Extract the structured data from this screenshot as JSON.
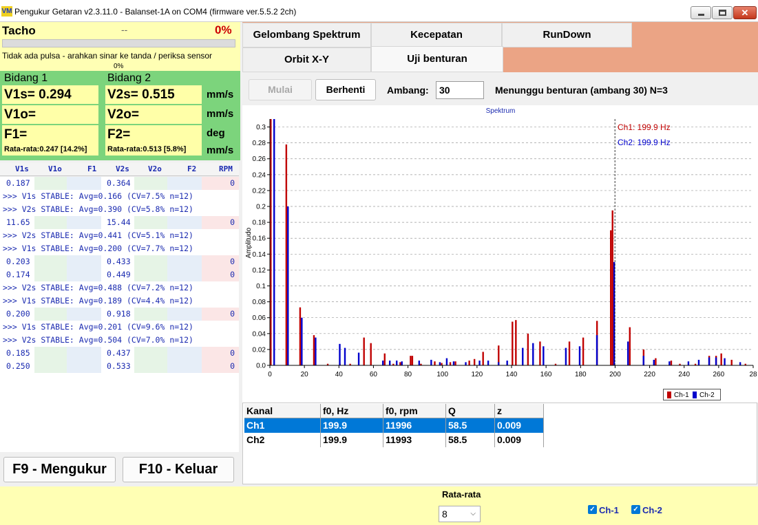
{
  "window": {
    "title": "Pengukur Getaran v2.3.11.0 - Balanset-1A on COM4 (firmware ver.5.5.2 2ch)",
    "icon_text": "VM",
    "close_glyph": "✕"
  },
  "tacho": {
    "label": "Tacho",
    "rpm": "--",
    "percent": "0%",
    "progress": 0,
    "message": "Tidak ada pulsa - arahkan sinar ke tanda / periksa sensor",
    "bar_percent": "0%"
  },
  "bidang1": {
    "title": "Bidang 1",
    "v1s": "V1s= 0.294",
    "v1o": "V1o=",
    "f1": "F1=",
    "avg": "Rata-rata:0.247 [14.2%]"
  },
  "bidang2": {
    "title": "Bidang 2",
    "v2s": "V2s= 0.515",
    "v2o": "V2o=",
    "f2": "F2=",
    "avg": "Rata-rata:0.513 [5.8%]"
  },
  "units": [
    "mm/s",
    "mm/s",
    "deg",
    "mm/s"
  ],
  "log_columns": [
    "V1s",
    "V1o",
    "F1",
    "V2s",
    "V2o",
    "F2",
    "RPM"
  ],
  "log_rows": [
    {
      "type": "data",
      "v1s": "0.187",
      "v2s": "0.364",
      "rpm": "0"
    },
    {
      "type": "stable",
      "text": ">>> V1s STABLE: Avg=0.166 (CV=7.5% n=12)"
    },
    {
      "type": "stable",
      "text": ">>> V2s STABLE: Avg=0.390 (CV=5.8% n=12)"
    },
    {
      "type": "data",
      "v1s": "11.65",
      "v2s": "15.44",
      "rpm": "0"
    },
    {
      "type": "stable",
      "text": ">>> V2s STABLE: Avg=0.441 (CV=5.1% n=12)"
    },
    {
      "type": "stable",
      "text": ">>> V1s STABLE: Avg=0.200 (CV=7.7% n=12)"
    },
    {
      "type": "data",
      "v1s": "0.203",
      "v2s": "0.433",
      "rpm": "0"
    },
    {
      "type": "data",
      "v1s": "0.174",
      "v2s": "0.449",
      "rpm": "0"
    },
    {
      "type": "stable",
      "text": ">>> V2s STABLE: Avg=0.488 (CV=7.2% n=12)"
    },
    {
      "type": "stable",
      "text": ">>> V1s STABLE: Avg=0.189 (CV=4.4% n=12)"
    },
    {
      "type": "data",
      "v1s": "0.200",
      "v2s": "0.918",
      "rpm": "0"
    },
    {
      "type": "stable",
      "text": ">>> V1s STABLE: Avg=0.201 (CV=9.6% n=12)"
    },
    {
      "type": "stable",
      "text": ">>> V2s STABLE: Avg=0.504 (CV=7.0% n=12)"
    },
    {
      "type": "data",
      "v1s": "0.185",
      "v2s": "0.437",
      "rpm": "0"
    },
    {
      "type": "data",
      "v1s": "0.250",
      "v2s": "0.533",
      "rpm": "0"
    }
  ],
  "buttons": {
    "measure": "F9 - Mengukur",
    "exit": "F10 - Keluar",
    "start": "Mulai",
    "stop": "Berhenti"
  },
  "tabs": {
    "row1": [
      "Gelombang  Spektrum",
      "Kecepatan",
      "RunDown"
    ],
    "row2": [
      "Orbit X-Y",
      "Uji benturan"
    ],
    "active": "Uji benturan"
  },
  "toolbar": {
    "threshold_label": "Ambang:",
    "threshold_value": "30",
    "status": "Menunggu benturan (ambang 30)  N=3"
  },
  "chart_data": {
    "type": "bar",
    "title": "Spektrum",
    "xlabel": "",
    "ylabel": "Amplitudo",
    "xlim": [
      0,
      280
    ],
    "ylim": [
      0,
      0.31
    ],
    "x_ticks": [
      0,
      20,
      40,
      60,
      80,
      100,
      120,
      140,
      160,
      180,
      200,
      220,
      240,
      260,
      280
    ],
    "x_tick_labels": [
      "0",
      "20",
      "40",
      "60",
      "80",
      "100",
      "120",
      "140",
      "160",
      "180",
      "200",
      "220",
      "240",
      "260",
      "28"
    ],
    "y_ticks": [
      0.0,
      0.02,
      0.04,
      0.06,
      0.08,
      0.1,
      0.12,
      0.14,
      0.16,
      0.18,
      0.2,
      0.22,
      0.24,
      0.26,
      0.28,
      0.3
    ],
    "y_tick_labels": [
      "0.0",
      "0.02",
      "0.04",
      "0.06",
      "0.08",
      "0.1",
      "0.12",
      "0.14",
      "0.16",
      "0.18",
      "0.2",
      "0.22",
      "0.24",
      "0.26",
      "0.28",
      "0.3"
    ],
    "grid": true,
    "legend": "bottom-right",
    "marker": {
      "x": 199.9
    },
    "annotations": [
      "Ch1: 199.9 Hz",
      "Ch2: 199.9 Hz"
    ],
    "series": [
      {
        "name": "Ch-1",
        "color": "#c00000",
        "x": [
          1,
          10,
          18,
          26,
          34,
          41,
          47,
          55,
          59,
          67,
          72,
          76,
          82,
          83,
          88,
          96,
          100,
          105,
          108,
          116,
          119,
          124,
          133,
          141,
          143,
          150,
          157,
          166,
          174,
          182,
          190,
          198,
          199,
          209,
          217,
          224,
          233,
          238,
          247,
          255,
          259,
          262,
          268,
          276
        ],
        "values": [
          0.31,
          0.278,
          0.073,
          0.038,
          0.002,
          0.002,
          0.002,
          0.035,
          0.028,
          0.015,
          0.002,
          0.004,
          0.012,
          0.012,
          0.002,
          0.005,
          0.003,
          0.004,
          0.005,
          0.006,
          0.008,
          0.017,
          0.025,
          0.055,
          0.057,
          0.04,
          0.03,
          0.002,
          0.03,
          0.035,
          0.056,
          0.17,
          0.195,
          0.048,
          0.02,
          0.009,
          0.006,
          0.002,
          0.002,
          0.012,
          0.012,
          0.015,
          0.007,
          0.002
        ]
      },
      {
        "name": "Ch-2",
        "color": "#0000cc",
        "x": [
          2,
          10,
          18,
          26,
          40,
          43,
          51,
          65,
          69,
          73,
          76,
          86,
          93,
          98,
          102,
          106,
          113,
          121,
          126,
          132,
          137,
          146,
          152,
          158,
          171,
          179,
          189,
          199,
          207,
          216,
          222,
          231,
          242,
          248,
          254,
          258,
          263,
          272
        ],
        "values": [
          0.31,
          0.2,
          0.06,
          0.035,
          0.027,
          0.022,
          0.016,
          0.006,
          0.006,
          0.006,
          0.005,
          0.006,
          0.007,
          0.004,
          0.009,
          0.005,
          0.004,
          0.006,
          0.006,
          0.004,
          0.006,
          0.022,
          0.028,
          0.024,
          0.022,
          0.024,
          0.038,
          0.13,
          0.03,
          0.012,
          0.007,
          0.005,
          0.005,
          0.007,
          0.01,
          0.01,
          0.009,
          0.004
        ]
      }
    ]
  },
  "result_table": {
    "columns": [
      "Kanal",
      "f0, Hz",
      "f0, rpm",
      "Q",
      "z"
    ],
    "rows": [
      [
        "Ch1",
        "199.9",
        "11996",
        "58.5",
        "0.009"
      ],
      [
        "Ch2",
        "199.9",
        "11993",
        "58.5",
        "0.009"
      ]
    ]
  },
  "averaging": {
    "label": "Rata-rata",
    "value": "8"
  },
  "channels": [
    "Ch-1",
    "Ch-2"
  ],
  "check_glyph": "✓",
  "chevron_glyph": "⌵"
}
